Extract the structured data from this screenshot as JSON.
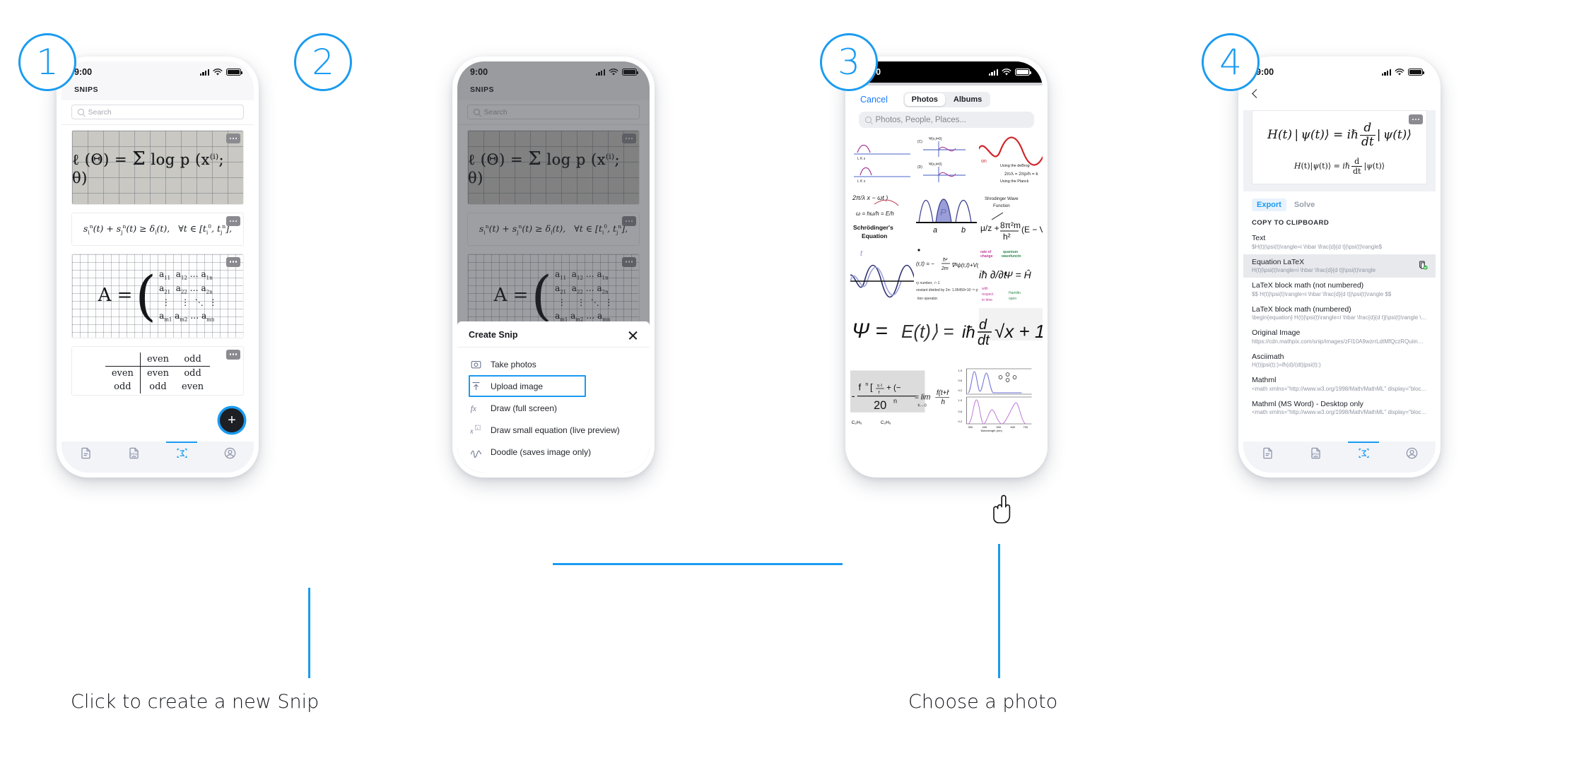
{
  "steps": [
    {
      "number": "1"
    },
    {
      "number": "2"
    },
    {
      "number": "3"
    },
    {
      "number": "4"
    }
  ],
  "captions": {
    "step1": "Click to create a new Snip",
    "step3": "Choose a photo"
  },
  "colors": {
    "accent": "#1a9bf0",
    "ios_blue": "#1a7afd",
    "tab_inactive": "#8d93ab",
    "sheet_bg": "#ffffff",
    "dim": "rgba(40,42,48,0.45)"
  },
  "status_bar": {
    "time": "9:00"
  },
  "phone1": {
    "app_title": "SNIPS",
    "search_placeholder": "Search",
    "snips": [
      {
        "kind": "grid-photo",
        "formula": "ℓ (Θ) = ∑ log p (x⁽ⁱ⁾; θ)"
      },
      {
        "kind": "formula",
        "formula": "sⁱⁿ(t) + sⱼⁿ(t) ≥ δᵢ(t),  ∀t ∈ [tᵢ⁰, tⱼⁿ]"
      },
      {
        "kind": "matrix",
        "formula": "A = (a₁₁ a₁₂ ... a₁ₙ / a₂₁ a₂₂ ... a₂ₙ / ... / aₘ₁ aₘ₂ ... aₘₙ)"
      },
      {
        "kind": "truth-table",
        "rows": [
          [
            "",
            "even",
            "odd"
          ],
          [
            "even",
            "even",
            "odd"
          ],
          [
            "odd",
            "odd",
            "even"
          ]
        ]
      }
    ],
    "fab_label": "+",
    "tabs": [
      {
        "icon": "document-icon",
        "active": false
      },
      {
        "icon": "pdf-icon",
        "active": false
      },
      {
        "icon": "sigma-scan-icon",
        "active": true
      },
      {
        "icon": "profile-icon",
        "active": false
      }
    ]
  },
  "phone2": {
    "sheet_title": "Create Snip",
    "close_label": "",
    "menu": [
      {
        "label": "Take photos",
        "icon": "camera-icon",
        "highlighted": false
      },
      {
        "label": "Upload image",
        "icon": "upload-icon",
        "highlighted": true
      },
      {
        "label": "Draw (full screen)",
        "icon": "fx-icon",
        "highlighted": false
      },
      {
        "label": "Draw small equation (live preview)",
        "icon": "x-superscript-icon",
        "highlighted": false
      },
      {
        "label": "Doodle (saves image only)",
        "icon": "doodle-icon",
        "highlighted": false
      }
    ]
  },
  "phone3": {
    "cancel_label": "Cancel",
    "segments": [
      {
        "label": "Photos",
        "selected": true
      },
      {
        "label": "Albums",
        "selected": false
      }
    ],
    "search_placeholder": "Photos, People, Places...",
    "gallery_note": "Schrödinger's Equation",
    "photo_labels": [
      "wave-plots",
      "psi-graphs",
      "red-sine-wave",
      "debroglie-notes",
      "probability-peaks",
      "schrodinger-equation",
      "wave-function-note",
      "blue-waves",
      "hbar-equation",
      "psi-equals-e",
      "derivative-formula",
      "sqrt-x-plus-15",
      "fraction-20n",
      "limit-definition",
      "spectra-chart",
      "chemistry-c2h5",
      "chemistry-c2h5-2",
      "molecule-cooh"
    ]
  },
  "phone4": {
    "equation_display": "H(t) | ψ(t)⟩ = iħ d/dt | ψ(t)⟩",
    "equation_rendered": "H(t)|ψ(t)⟩ = iħ d/dt |ψ(t)⟩",
    "tabs": [
      {
        "label": "Export",
        "selected": true
      },
      {
        "label": "Solve",
        "selected": false
      }
    ],
    "section_title": "COPY TO CLIPBOARD",
    "clipboard_items": [
      {
        "title": "Text",
        "value": "$H(t)|\\psi(t)\\rangle=i \\hbar \\frac{d}{d t}|\\psi(t)\\rangle$",
        "selected": false,
        "copied": false
      },
      {
        "title": "Equation LaTeX",
        "value": "H(t)|\\psi(t)\\rangle=i \\hbar \\frac{d}{d t}|\\psi(t)\\rangle",
        "selected": true,
        "copied": true
      },
      {
        "title": "LaTeX block math (not numbered)",
        "value": "$$ H(t)|\\psi(t)\\rangle=i \\hbar \\frac{d}{d t}|\\psi(t)\\rangle $$",
        "selected": false,
        "copied": false
      },
      {
        "title": "LaTeX block math (numbered)",
        "value": "\\begin{equation} H(t)|\\psi(t)\\rangle=i \\hbar \\frac{d}{d t}|\\psi(t)\\rangle \\end{...",
        "selected": false,
        "copied": false
      },
      {
        "title": "Original Image",
        "value": "https://cdn.mathpix.com/snip/images/zFl10A9wzrrLdtMfQczRQuiinQXBpkU...",
        "selected": false,
        "copied": false
      },
      {
        "title": "Asciimath",
        "value": "H(t)|psi(t):)=iħ(d)/(dt)|psi(t):)",
        "selected": false,
        "copied": false
      },
      {
        "title": "Mathml",
        "value": "<math xmlns=\"http://www.w3.org/1998/Math/MathML\" display=\"block\"> <...",
        "selected": false,
        "copied": false
      },
      {
        "title": "Mathml (MS Word) - Desktop only",
        "value": "<math xmlns=\"http://www.w3.org/1998/Math/MathML\" display=\"block\"> <...",
        "selected": false,
        "copied": false
      }
    ],
    "tabs_bottom": [
      {
        "icon": "document-icon",
        "active": false
      },
      {
        "icon": "pdf-icon",
        "active": false
      },
      {
        "icon": "sigma-scan-icon",
        "active": true
      },
      {
        "icon": "profile-icon",
        "active": false
      }
    ]
  }
}
